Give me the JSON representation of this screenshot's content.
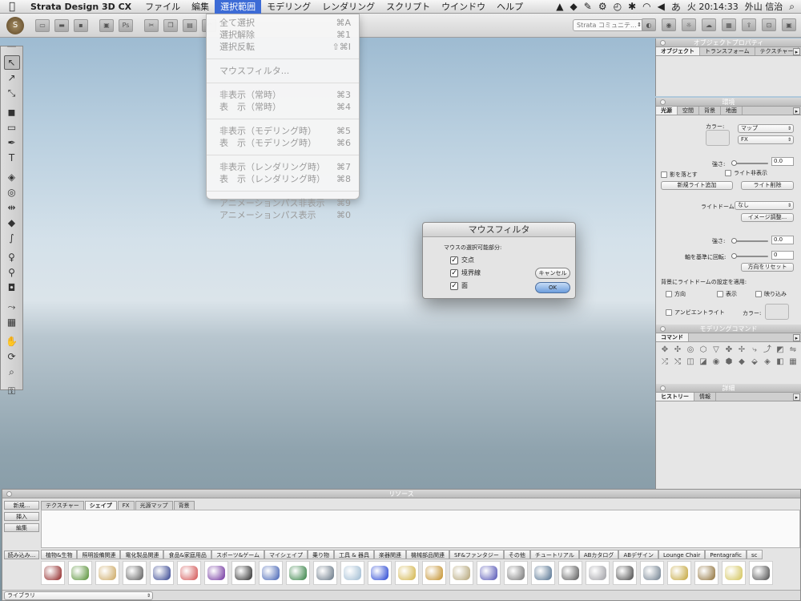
{
  "menubar": {
    "app_name": "Strata Design 3D CX",
    "items": [
      "ファイル",
      "編集",
      "選択範囲",
      "モデリング",
      "レンダリング",
      "スクリプト",
      "ウインドウ",
      "ヘルプ"
    ],
    "active_index": 2,
    "clock": "火 20:14:33",
    "user": "外山 信治"
  },
  "toolbar": {
    "community_placeholder": "Strata コミュニテ..."
  },
  "selection_menu": {
    "groups": [
      [
        {
          "label": "全て選択",
          "shortcut": "⌘A"
        },
        {
          "label": "選択解除",
          "shortcut": "⌘1"
        },
        {
          "label": "選択反転",
          "shortcut": "⇧⌘I"
        }
      ],
      [
        {
          "label": "マウスフィルタ...",
          "shortcut": ""
        }
      ],
      [
        {
          "label": "非表示（常時）",
          "shortcut": "⌘3"
        },
        {
          "label": "表　示（常時）",
          "shortcut": "⌘4"
        }
      ],
      [
        {
          "label": "非表示（モデリング時）",
          "shortcut": "⌘5"
        },
        {
          "label": "表　示（モデリング時）",
          "shortcut": "⌘6"
        }
      ],
      [
        {
          "label": "非表示（レンダリング時）",
          "shortcut": "⌘7"
        },
        {
          "label": "表　示（レンダリング時）",
          "shortcut": "⌘8"
        }
      ],
      [
        {
          "label": "アニメーションパス非表示",
          "shortcut": "⌘9"
        },
        {
          "label": "アニメーションパス表示",
          "shortcut": "⌘0"
        }
      ]
    ]
  },
  "mouse_filter_dialog": {
    "title": "マウスフィルタ",
    "subtitle": "マウスの選択可能部分:",
    "options": [
      {
        "label": "交点",
        "checked": true
      },
      {
        "label": "境界線",
        "checked": true
      },
      {
        "label": "面",
        "checked": true
      }
    ],
    "cancel_label": "キャンセル",
    "ok_label": "OK"
  },
  "object_properties": {
    "title": "オブジェクトプロパティ",
    "tabs": [
      "オブジェクト",
      "トランスフォーム",
      "テクスチャー"
    ]
  },
  "environment": {
    "title": "環境",
    "tabs": [
      "光源",
      "空間",
      "背景",
      "地面"
    ],
    "color_label": "カラー:",
    "map_select": "マップ",
    "fx_select": "FX",
    "strength_label": "強さ:",
    "strength_value": "0.0",
    "shadow_label": "影を落とす",
    "light_hide_label": "ライト非表示",
    "add_light_button": "新規ライト追加",
    "delete_light_button": "ライト削除",
    "light_dome_label": "ライトドーム:",
    "light_dome_value": "なし",
    "image_adjust_button": "イメージ調整...",
    "strength2_label": "強さ:",
    "strength2_value": "0.0",
    "rotate_label": "軸を基準に回転:",
    "rotate_value": "0",
    "reset_direction_button": "方向をリセット",
    "bg_dome_label": "背景にライトドームの設定を適用:",
    "direction_label": "方向",
    "display_label": "表示",
    "reflect_label": "映り込み",
    "ambient_label": "アンビエントライト",
    "ambient_color_label": "カラー:"
  },
  "modeling_commands": {
    "title": "モデリングコマンド",
    "tab": "コマンド"
  },
  "details": {
    "title": "詳細",
    "tabs": [
      "ヒストリー",
      "情報"
    ]
  },
  "resources": {
    "title": "リソース",
    "side_buttons": [
      "新規...",
      "挿入",
      "編集",
      "読み込み..."
    ],
    "tabs": [
      "テクスチャー",
      "シェイプ",
      "FX",
      "光源マップ",
      "背景"
    ],
    "active_tab": 1,
    "categories": [
      "植物&生物",
      "照明設備関連",
      "電化製品関連",
      "食品&家庭用品",
      "スポーツ&ゲーム",
      "マイシェイプ",
      "乗り物",
      "工具 & 器具",
      "楽器関連",
      "機械部品関連",
      "SF&ファンタジー",
      "その他",
      "チュートリアル",
      "ABカタログ",
      "ABデザイン",
      "Lounge Chair",
      "Pentagrafic",
      "sc"
    ],
    "thumb_colors": [
      "#8a1a1a",
      "#4d8a2a",
      "#c9a35a",
      "#555555",
      "#2a3a8a",
      "#d04a4a",
      "#6a2a9a",
      "#222222",
      "#3a5ab0",
      "#2a7a3a",
      "#607080",
      "#9ab8d0",
      "#1a3ad0",
      "#d0b040",
      "#c08a20",
      "#b0a070",
      "#4a4ab0",
      "#707070",
      "#4a6a8a",
      "#505050",
      "#9a9aa0",
      "#404040",
      "#6a7a8a",
      "#c0a030",
      "#8a6a30",
      "#d0c050",
      "#444444"
    ],
    "library_select": "ライブラリ"
  },
  "colors": {
    "menu_highlight": "#3c6bd6",
    "ok_button": "#6c9ddc"
  }
}
